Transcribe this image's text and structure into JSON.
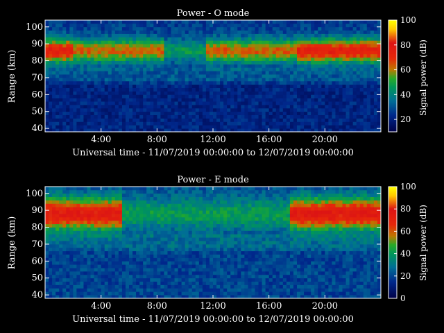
{
  "chart_data": [
    {
      "type": "heatmap",
      "title": "Power - O mode",
      "xlabel": "Universal time - 11/07/2019 00:00:00 to 12/07/2019 00:00:00",
      "ylabel": "Range (km)",
      "xlim": [
        0,
        24
      ],
      "ylim": [
        38,
        104
      ],
      "x_ticks": [
        "4:00",
        "8:00",
        "12:00",
        "16:00",
        "20:00"
      ],
      "y_ticks": [
        "40",
        "50",
        "60",
        "70",
        "80",
        "90",
        "100"
      ],
      "colorbar": {
        "label": "Signal power (dB)",
        "ticks": [
          "20",
          "40",
          "60",
          "80",
          "100"
        ],
        "range": [
          10,
          100
        ]
      }
    },
    {
      "type": "heatmap",
      "title": "Power - E mode",
      "xlabel": "Universal time - 11/07/2019 00:00:00 to 12/07/2019 00:00:00",
      "ylabel": "Range (km)",
      "xlim": [
        0,
        24
      ],
      "ylim": [
        38,
        104
      ],
      "x_ticks": [
        "4:00",
        "8:00",
        "12:00",
        "16:00",
        "20:00"
      ],
      "y_ticks": [
        "40",
        "50",
        "60",
        "70",
        "80",
        "90",
        "100"
      ],
      "colorbar": {
        "label": "Signal power (dB)",
        "ticks": [
          "0",
          "20",
          "40",
          "60",
          "80",
          "100"
        ],
        "range": [
          0,
          100
        ]
      }
    }
  ]
}
